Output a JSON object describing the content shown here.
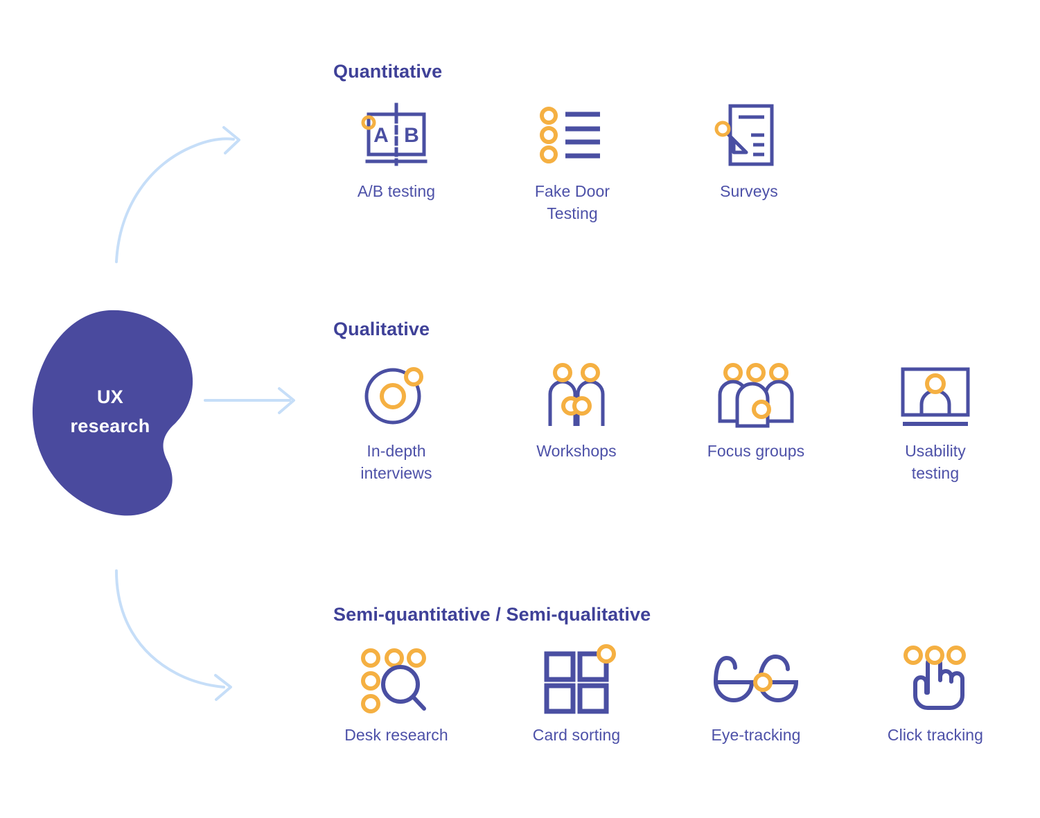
{
  "colors": {
    "blob": "#4a4a9e",
    "heading": "#3f4198",
    "label": "#4d51a8",
    "icon_blue": "#4a4fa2",
    "icon_orange": "#f5b042",
    "arrow": "#c6deF8",
    "background": "#ffffff",
    "blob_text": "#ffffff"
  },
  "center": {
    "name": "ux-research-node",
    "line1": "UX",
    "line2": "research"
  },
  "arrows": [
    {
      "name": "arrow-to-quantitative",
      "style": "curved-up",
      "icon": "arrow-curved-up-icon"
    },
    {
      "name": "arrow-to-qualitative",
      "style": "straight",
      "icon": "arrow-right-icon"
    },
    {
      "name": "arrow-to-semi",
      "style": "curved-down",
      "icon": "arrow-curved-down-icon"
    }
  ],
  "sections": [
    {
      "id": "quantitative",
      "title": "Quantitative",
      "items": [
        {
          "id": "ab",
          "label": "A/B testing",
          "icon": "ab-testing-icon"
        },
        {
          "id": "fakedoor",
          "label": "Fake Door\nTesting",
          "label_line1": "Fake Door",
          "label_line2": "Testing",
          "icon": "list-checklist-icon"
        },
        {
          "id": "surveys",
          "label": "Surveys",
          "icon": "document-pencil-icon"
        }
      ]
    },
    {
      "id": "qualitative",
      "title": "Qualitative",
      "items": [
        {
          "id": "interviews",
          "label": "In-depth\ninterviews",
          "label_line1": "In-depth",
          "label_line2": "interviews",
          "icon": "circle-orbit-icon"
        },
        {
          "id": "workshops",
          "label": "Workshops",
          "icon": "two-people-handshake-icon"
        },
        {
          "id": "focus",
          "label": "Focus groups",
          "icon": "three-people-group-icon"
        },
        {
          "id": "usability",
          "label": "Usability\ntesting",
          "label_line1": "Usability",
          "label_line2": "testing",
          "icon": "monitor-person-icon"
        }
      ]
    },
    {
      "id": "semi",
      "title": "Semi-quantitative / Semi-qualitative",
      "items": [
        {
          "id": "desk",
          "label": "Desk research",
          "icon": "magnifier-dots-icon"
        },
        {
          "id": "cardsort",
          "label": "Card sorting",
          "icon": "four-squares-grid-icon"
        },
        {
          "id": "eye",
          "label": "Eye-tracking",
          "icon": "glasses-icon"
        },
        {
          "id": "click",
          "label": "Click tracking",
          "icon": "pointing-hand-icon"
        }
      ]
    }
  ]
}
